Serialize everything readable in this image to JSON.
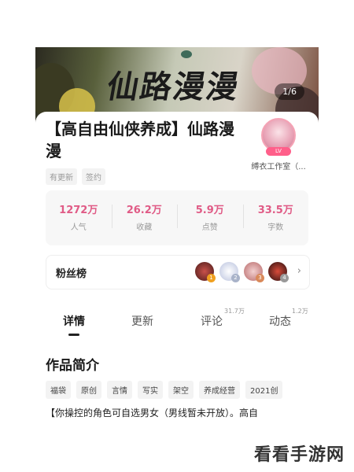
{
  "banner": {
    "art_title": "仙路漫漫",
    "image_counter": "1/6"
  },
  "work": {
    "title": "【高自由仙侠养成】仙路漫漫",
    "status_tags": [
      "有更新",
      "签约"
    ]
  },
  "studio": {
    "badge": "LV",
    "name": "缚衣工作室（..."
  },
  "stats": [
    {
      "value": "1272万",
      "label": "人气"
    },
    {
      "value": "26.2万",
      "label": "收藏"
    },
    {
      "value": "5.9万",
      "label": "点赞"
    },
    {
      "value": "33.5万",
      "label": "字数"
    }
  ],
  "fans": {
    "label": "粉丝榜",
    "ranks": [
      "1",
      "2",
      "3",
      "4"
    ],
    "chevron": "›"
  },
  "tabs": [
    {
      "label": "详情",
      "count": ""
    },
    {
      "label": "更新",
      "count": ""
    },
    {
      "label": "评论",
      "count": "31.7万"
    },
    {
      "label": "动态",
      "count": "1.2万"
    }
  ],
  "intro": {
    "heading": "作品简介",
    "tags": [
      "福袋",
      "原创",
      "言情",
      "写实",
      "架空",
      "养成经营",
      "2021创"
    ],
    "description": "【你操控的角色可自选男女（男线暂未开放）。高自"
  },
  "watermark": "看看手游网",
  "colors": {
    "accent": "#e05b86",
    "badge": "#ff5f8a"
  }
}
